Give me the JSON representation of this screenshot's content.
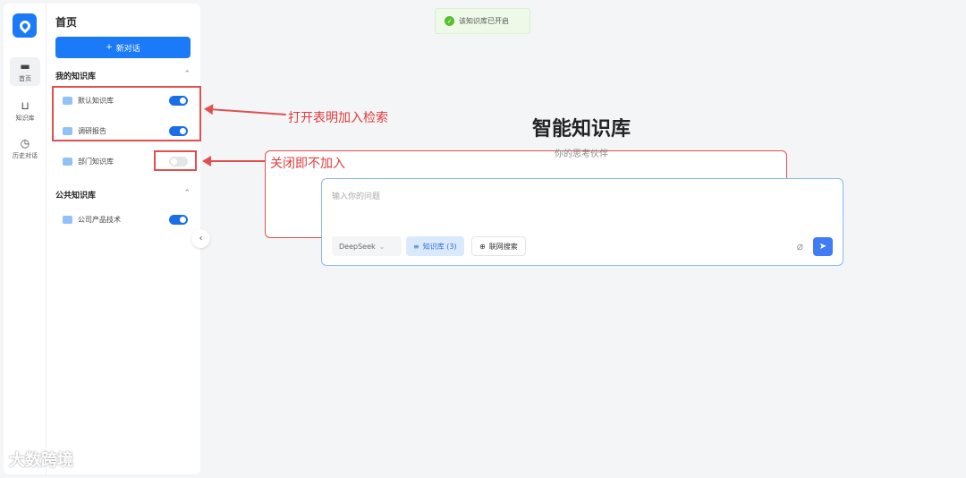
{
  "rail": {
    "items": [
      {
        "label": "首页",
        "icon": "chat-icon"
      },
      {
        "label": "知识库",
        "icon": "knowledge-icon"
      },
      {
        "label": "历史对话",
        "icon": "clock-icon"
      }
    ]
  },
  "sidebar": {
    "title": "首页",
    "new_chat": "新对话",
    "my_kb": {
      "title": "我的知识库",
      "items": [
        {
          "label": "默认知识库",
          "enabled": true
        },
        {
          "label": "调研报告",
          "enabled": true
        },
        {
          "label": "部门知识库",
          "enabled": false
        }
      ]
    },
    "public_kb": {
      "title": "公共知识库",
      "items": [
        {
          "label": "公司产品技术",
          "enabled": true
        }
      ]
    }
  },
  "annotations": {
    "on": "打开表明加入检索",
    "off": "关闭即不加入"
  },
  "toast": "该知识库已开启",
  "main": {
    "title": "智能知识库",
    "subtitle": "你的思考伙伴",
    "input_placeholder": "输入你的问题",
    "model": "DeepSeek",
    "kb_chip": "知识库 (3)",
    "web_search": "联网搜索"
  },
  "watermark": "大数跨境",
  "colors": {
    "accent": "#1a7af8",
    "annotation": "#e05050"
  }
}
